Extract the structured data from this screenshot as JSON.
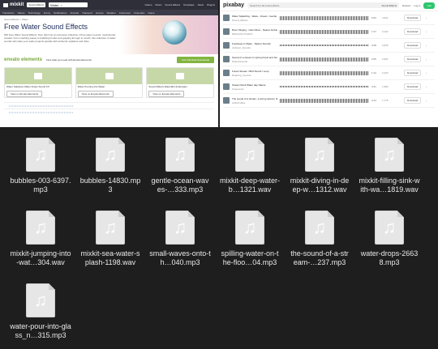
{
  "mixkit": {
    "logo": "mixkit",
    "category_select": "Sound Effects",
    "search_value": "Water",
    "nav_links": [
      "Videos",
      "Music",
      "Sound Effects",
      "Templates",
      "Stock",
      "Plugins"
    ],
    "subnav": [
      "Transitions",
      "Nature",
      "Technology",
      "Funny",
      "Notifications",
      "Animals",
      "Transport",
      "Human",
      "Weather",
      "Instrument",
      "Cinematic",
      "Game"
    ],
    "breadcrumb": "Sound Effects  >  Water",
    "title": "Free Water Sound Effects",
    "description": "300 Free Water Sound Effects. Dive right into an extensive collection of free water sounds, meticulously created. From crashing waves to babbling brooks and gurgling through to a bath, this collection of water sounds will make your audio projects sparkle with authentic splashes and drips.",
    "envato_logo": "envato elements",
    "envato_text": "Find what you need with Envato Elements",
    "envato_button": "Get Unlimited Downloads",
    "cards": [
      {
        "title": "Water Splashes Water Drops Sound FX",
        "button": "View on Envato Elements"
      },
      {
        "title": "Water Pouring Into Water",
        "button": "View on Envato Elements"
      },
      {
        "title": "Sound Effects Waterfall Underwater",
        "button": "View on Envato Elements"
      }
    ]
  },
  "pixabay": {
    "logo": "pixabay",
    "search_placeholder": "Search for all sound effects",
    "search_filter": "Sound Effects",
    "nav_links": [
      "Explore",
      "Log in",
      "Join"
    ],
    "rows": [
      {
        "title": "Water Splashing - Wave - Ocean - Gentle Sound",
        "author": "Sound_Effects",
        "time": "0:03",
        "stats": "4,921",
        "download": "Download"
      },
      {
        "title": "River Singing - Calm River - Nature Ambience",
        "author": "DRAGON-STUDIO",
        "time": "1:37",
        "stats": "3,102",
        "download": "Download"
      },
      {
        "title": "Footsteps in Water - Nature Sounds",
        "author": "Ambient_Sounds",
        "time": "0:38",
        "stats": "2,845",
        "download": "Download"
      },
      {
        "title": "Sound of a stream in spring forest and birdsong",
        "author": "NatureSounds",
        "time": "2:05",
        "stats": "2,501",
        "download": "Download"
      },
      {
        "title": "Forest Stream / Bird Sound / Loop",
        "author": "Relaxing_Sounds",
        "time": "1:12",
        "stats": "2,233",
        "download": "Download"
      },
      {
        "title": "Stream Rock Water day Nature",
        "author": "Freesound",
        "time": "0:41",
        "stats": "1,980",
        "download": "Download"
      },
      {
        "title": "The sound of a stream, a spring stream, flowing water",
        "author": "AudioCoffee",
        "time": "3:14",
        "stats": "1,776",
        "download": "Download"
      }
    ]
  },
  "files": [
    {
      "name": "bubbles-003-6397.mp3"
    },
    {
      "name": "bubbles-14830.mp3"
    },
    {
      "name": "gentle-ocean-waves-…333.mp3"
    },
    {
      "name": "mixkit-deep-water-b…1321.wav"
    },
    {
      "name": "mixkit-diving-in-deep-w…1312.wav"
    },
    {
      "name": "mixkit-filling-sink-with-wa…1819.wav"
    },
    {
      "name": "mixkit-jumping-into-wat…304.wav"
    },
    {
      "name": "mixkit-sea-water-splash-1198.wav"
    },
    {
      "name": "small-waves-onto-th…040.mp3"
    },
    {
      "name": "spilling-water-on-the-floo…04.mp3"
    },
    {
      "name": "the-sound-of-a-stream-…237.mp3"
    },
    {
      "name": "water-drops-26638.mp3"
    },
    {
      "name": "water-pour-into-glass_n…315.mp3"
    }
  ],
  "colors": {
    "finder_bg": "#1e1e1e",
    "mixkit_navbar": "#2f2f3a",
    "envato_green": "#82b440",
    "pixabay_join": "#2ec66d",
    "file_icon_bg": "#e6e6e6"
  },
  "icons": {
    "file": "music-note-icon",
    "search": "search-icon",
    "play": "play-icon",
    "globe": "water-globe-illustration"
  }
}
